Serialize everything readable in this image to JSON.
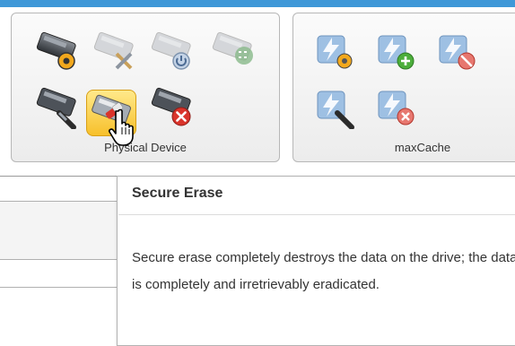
{
  "ribbon": {
    "physical_device_group": {
      "label": "Physical Device",
      "icons": [
        "drive-settings-icon",
        "drive-tools-icon",
        "drive-power-icon",
        "drive-binary-icon",
        "drive-locate-icon",
        "secure-erase-icon",
        "drive-delete-icon"
      ]
    },
    "maxcache_group": {
      "label": "maxCache",
      "icons": [
        "cache-settings-icon",
        "cache-add-icon",
        "cache-disable-icon",
        "cache-locate-icon",
        "cache-delete-icon"
      ]
    }
  },
  "tooltip": {
    "title": "Secure Erase",
    "body": "Secure erase completely destroys the data on the drive; the data is completely and irretrievably eradicated."
  },
  "colors": {
    "accent_bar": "#3f98d8",
    "hover_highlight": "#f7c02b",
    "error_red": "#d9342b",
    "add_green": "#4cae3b"
  }
}
